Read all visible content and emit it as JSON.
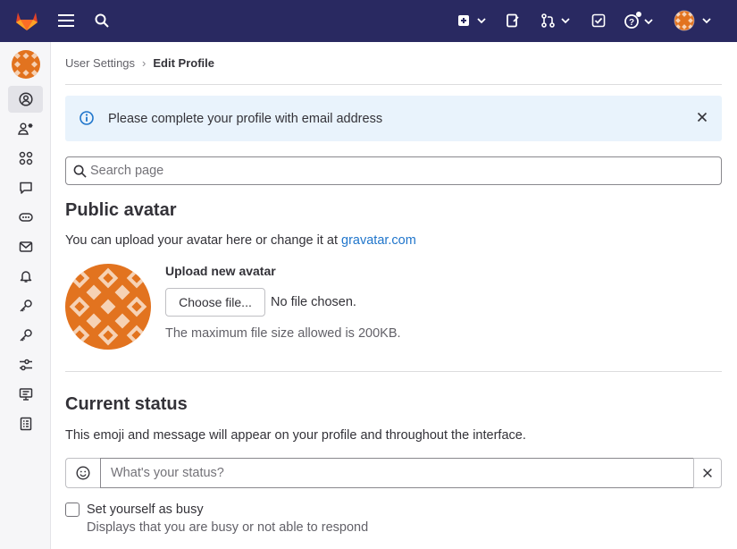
{
  "topbar": {
    "logo": "gitlab-tanuki-logo",
    "menu_icon": "hamburger-icon",
    "search_icon": "search-icon",
    "actions": [
      "new-item-icon",
      "issues-icon",
      "merge-requests-icon",
      "todos-icon",
      "help-icon",
      "user-avatar-menu"
    ]
  },
  "sidebar": {
    "items": [
      "profile-icon",
      "account-icon",
      "applications-icon",
      "chat-icon",
      "access-tokens-icon",
      "emails-icon",
      "notifications-icon",
      "ssh-keys-icon",
      "gpg-keys-icon",
      "preferences-icon",
      "active-sessions-icon",
      "authentication-log-icon"
    ],
    "active_index": 0
  },
  "breadcrumb": {
    "parent": "User Settings",
    "current": "Edit Profile",
    "separator": "›"
  },
  "alert": {
    "text": "Please complete your profile with email address"
  },
  "search": {
    "placeholder": "Search page"
  },
  "avatar_section": {
    "title": "Public avatar",
    "description": "You can upload your avatar here or change it at ",
    "link_text": "gravatar.com",
    "upload_label": "Upload new avatar",
    "choose_button": "Choose file...",
    "file_status": "No file chosen.",
    "hint": "The maximum file size allowed is 200KB."
  },
  "status_section": {
    "title": "Current status",
    "description": "This emoji and message will appear on your profile and throughout the interface.",
    "placeholder": "What's your status?",
    "busy_label": "Set yourself as busy",
    "busy_help": "Displays that you are busy or not able to respond",
    "busy_checked": false
  },
  "colors": {
    "topbar": "#292961",
    "accent_link": "#1f75cb",
    "alert_bg": "#e9f3fc",
    "avatar_orange": "#e2731f"
  }
}
